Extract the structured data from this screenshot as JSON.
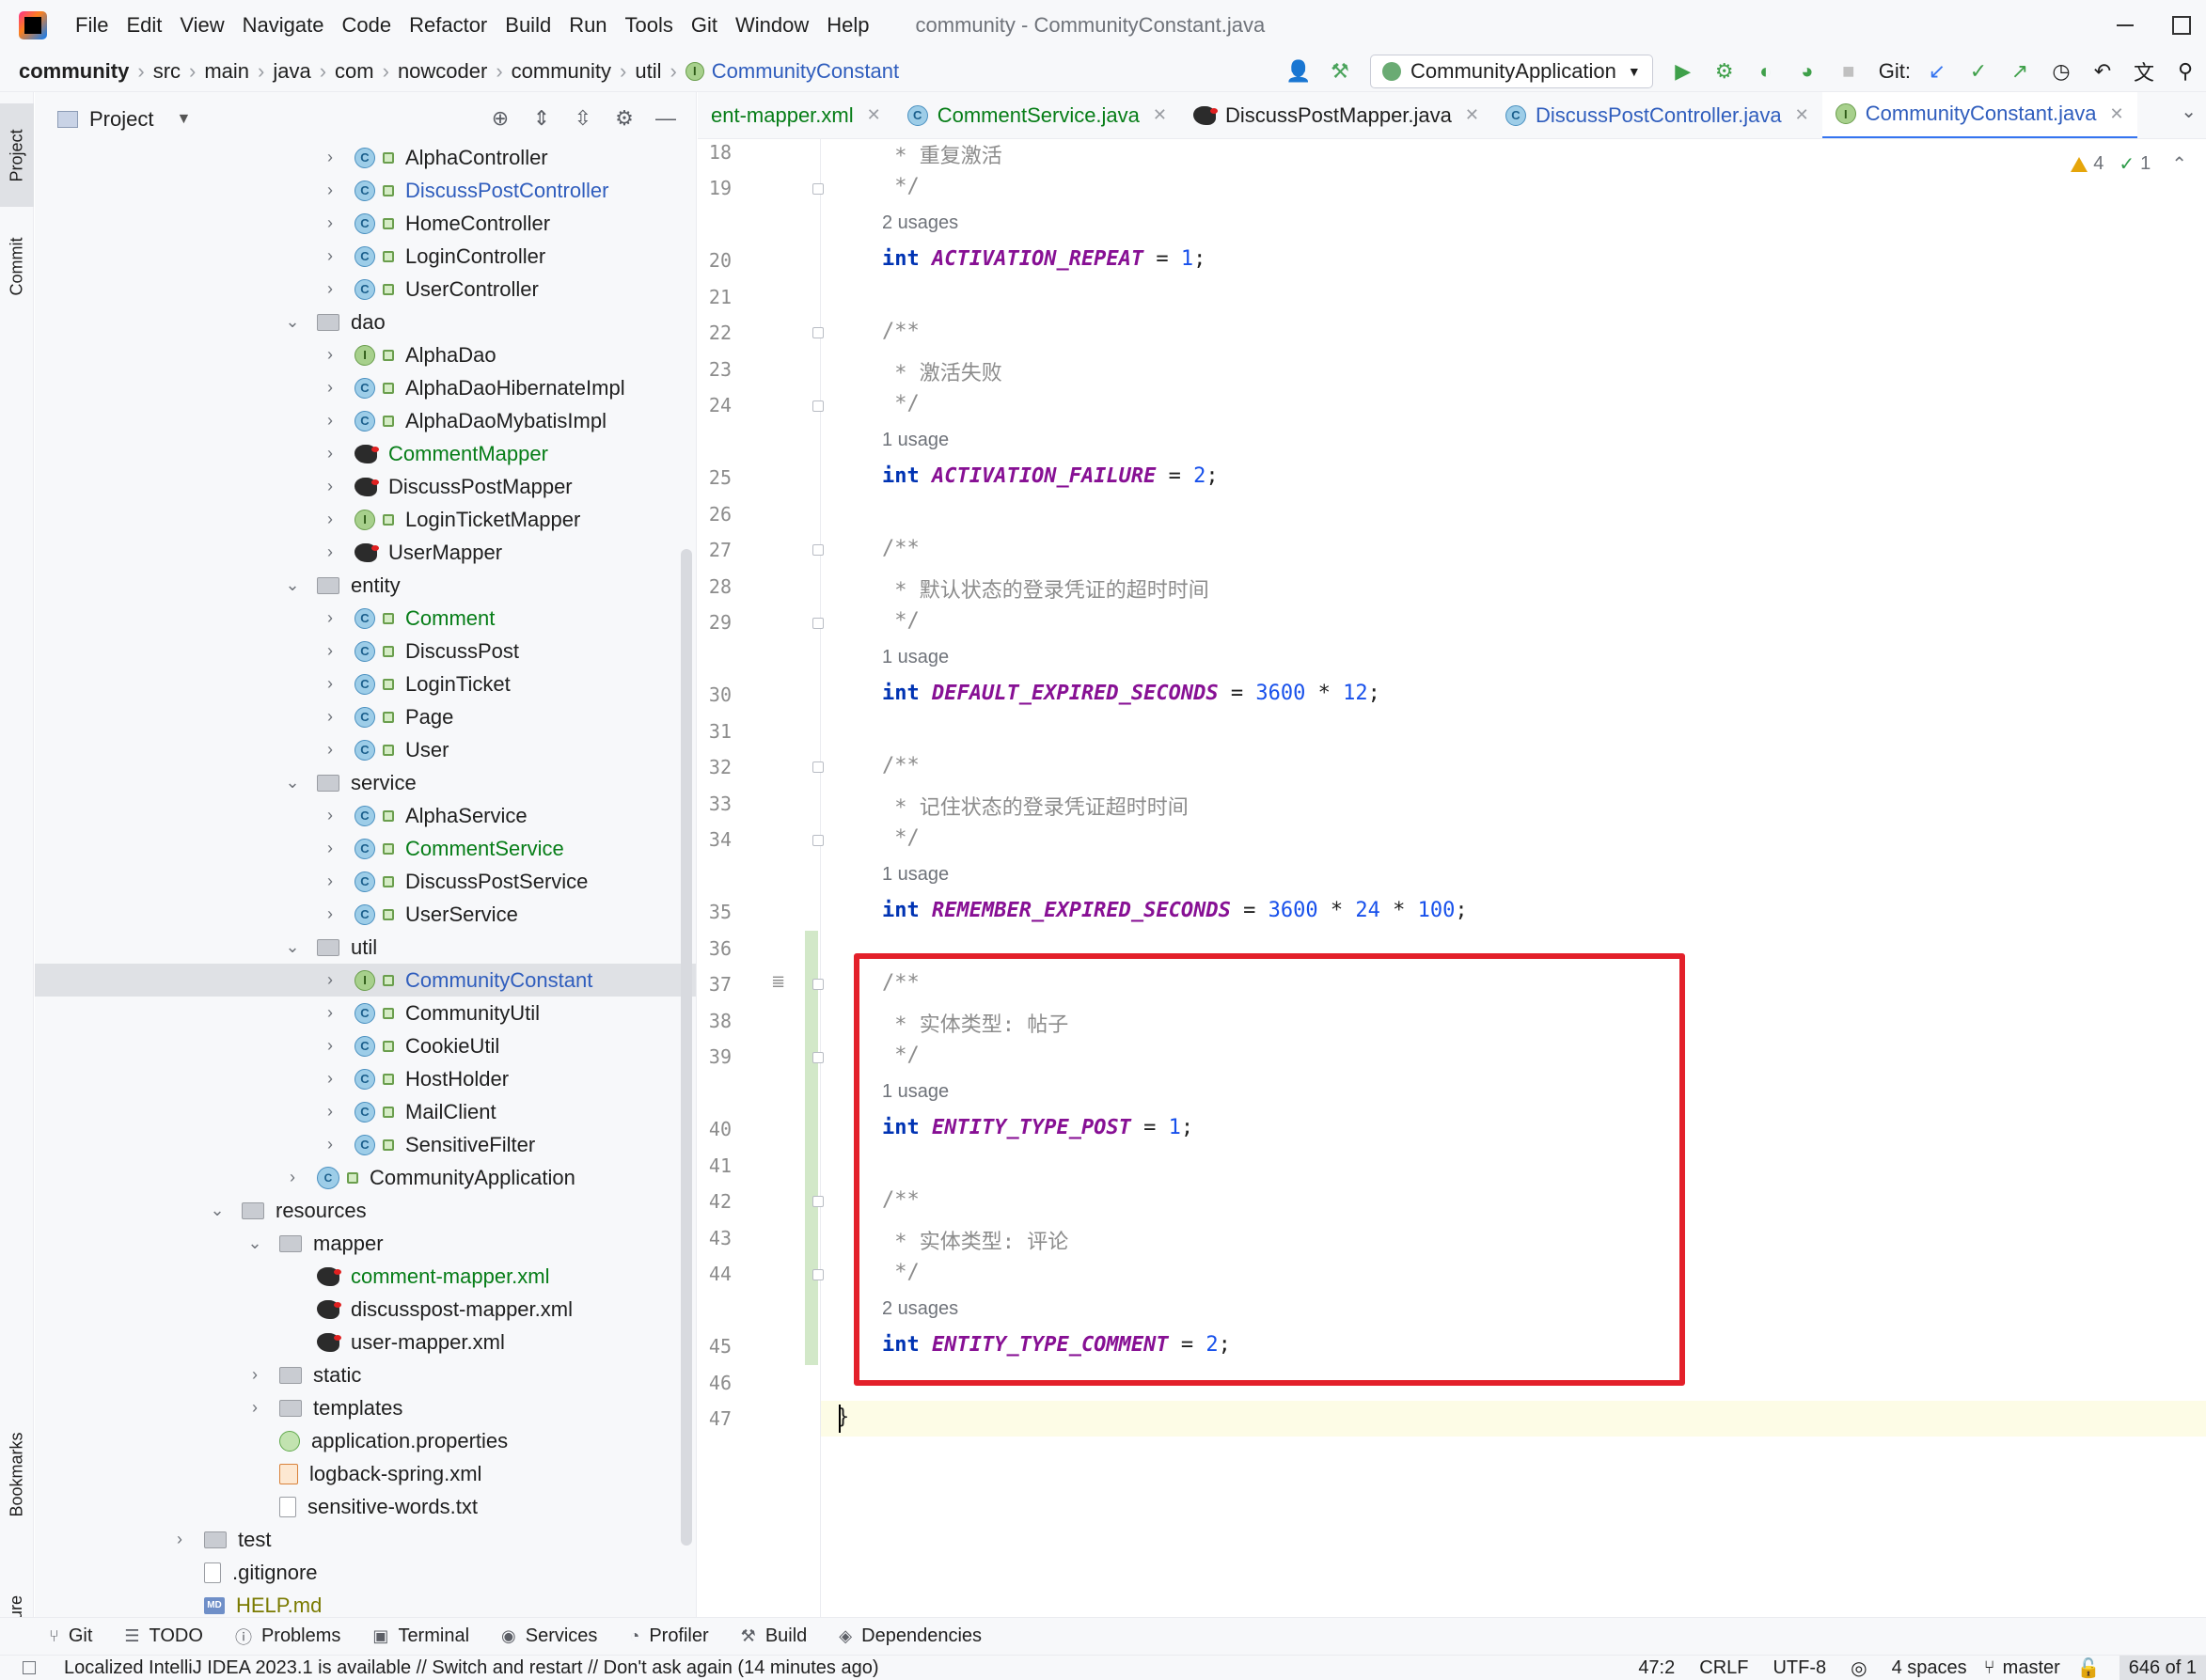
{
  "menubar": {
    "items": [
      "File",
      "Edit",
      "View",
      "Navigate",
      "Code",
      "Refactor",
      "Build",
      "Run",
      "Tools",
      "Git",
      "Window",
      "Help"
    ],
    "window_title": "community - CommunityConstant.java"
  },
  "breadcrumb": [
    "community",
    "src",
    "main",
    "java",
    "com",
    "nowcoder",
    "community",
    "util",
    "CommunityConstant"
  ],
  "toolbar": {
    "run_config": "CommunityApplication",
    "git_label": "Git:"
  },
  "left_strip": {
    "project": "Project",
    "commit": "Commit",
    "bookmarks": "Bookmarks",
    "structure": "Structure"
  },
  "project_panel": {
    "title": "Project",
    "tree": [
      {
        "label": "AlphaController",
        "icon": "class-icon",
        "color": "default"
      },
      {
        "label": "DiscussPostController",
        "icon": "class-icon",
        "color": "blue"
      },
      {
        "label": "HomeController",
        "icon": "class-icon",
        "color": "default"
      },
      {
        "label": "LoginController",
        "icon": "class-icon",
        "color": "default"
      },
      {
        "label": "UserController",
        "icon": "class-icon",
        "color": "default"
      },
      {
        "label": "dao",
        "icon": "package-icon",
        "color": "default"
      },
      {
        "label": "AlphaDao",
        "icon": "interface-icon",
        "color": "default"
      },
      {
        "label": "AlphaDaoHibernateImpl",
        "icon": "class-icon",
        "color": "default"
      },
      {
        "label": "AlphaDaoMybatisImpl",
        "icon": "class-icon",
        "color": "default"
      },
      {
        "label": "CommentMapper",
        "icon": "mybatis-icon",
        "color": "green"
      },
      {
        "label": "DiscussPostMapper",
        "icon": "mybatis-icon",
        "color": "default"
      },
      {
        "label": "LoginTicketMapper",
        "icon": "interface-icon",
        "color": "default"
      },
      {
        "label": "UserMapper",
        "icon": "mybatis-icon",
        "color": "default"
      },
      {
        "label": "entity",
        "icon": "package-icon",
        "color": "default"
      },
      {
        "label": "Comment",
        "icon": "class-icon",
        "color": "green"
      },
      {
        "label": "DiscussPost",
        "icon": "class-icon",
        "color": "default"
      },
      {
        "label": "LoginTicket",
        "icon": "class-icon",
        "color": "default"
      },
      {
        "label": "Page",
        "icon": "class-icon",
        "color": "default"
      },
      {
        "label": "User",
        "icon": "class-icon",
        "color": "default"
      },
      {
        "label": "service",
        "icon": "package-icon",
        "color": "default"
      },
      {
        "label": "AlphaService",
        "icon": "class-icon",
        "color": "default"
      },
      {
        "label": "CommentService",
        "icon": "class-icon",
        "color": "green"
      },
      {
        "label": "DiscussPostService",
        "icon": "class-icon",
        "color": "default"
      },
      {
        "label": "UserService",
        "icon": "class-icon",
        "color": "default"
      },
      {
        "label": "util",
        "icon": "package-icon",
        "color": "default"
      },
      {
        "label": "CommunityConstant",
        "icon": "interface-icon",
        "color": "blue"
      },
      {
        "label": "CommunityUtil",
        "icon": "class-icon",
        "color": "default"
      },
      {
        "label": "CookieUtil",
        "icon": "class-icon",
        "color": "default"
      },
      {
        "label": "HostHolder",
        "icon": "class-icon",
        "color": "default"
      },
      {
        "label": "MailClient",
        "icon": "class-icon",
        "color": "default"
      },
      {
        "label": "SensitiveFilter",
        "icon": "class-icon",
        "color": "default"
      },
      {
        "label": "CommunityApplication",
        "icon": "spring-app-icon",
        "color": "default"
      },
      {
        "label": "resources",
        "icon": "resources-folder-icon",
        "color": "default"
      },
      {
        "label": "mapper",
        "icon": "folder-icon",
        "color": "default"
      },
      {
        "label": "comment-mapper.xml",
        "icon": "mybatis-xml-icon",
        "color": "green"
      },
      {
        "label": "discusspost-mapper.xml",
        "icon": "mybatis-xml-icon",
        "color": "default"
      },
      {
        "label": "user-mapper.xml",
        "icon": "mybatis-xml-icon",
        "color": "default"
      },
      {
        "label": "static",
        "icon": "folder-icon",
        "color": "default"
      },
      {
        "label": "templates",
        "icon": "folder-icon",
        "color": "default"
      },
      {
        "label": "application.properties",
        "icon": "spring-properties-icon",
        "color": "default"
      },
      {
        "label": "logback-spring.xml",
        "icon": "xml-icon",
        "color": "default"
      },
      {
        "label": "sensitive-words.txt",
        "icon": "text-file-icon",
        "color": "default"
      },
      {
        "label": "test",
        "icon": "folder-icon",
        "color": "default"
      },
      {
        "label": ".gitignore",
        "icon": "text-file-icon",
        "color": "default"
      },
      {
        "label": "HELP.md",
        "icon": "markdown-icon",
        "color": "olive"
      }
    ],
    "selected": "CommunityConstant"
  },
  "editor_tabs": [
    {
      "label": "ent-mapper.xml",
      "icon": "mybatis-xml-icon",
      "color": "green"
    },
    {
      "label": "CommentService.java",
      "icon": "class-icon",
      "color": "green"
    },
    {
      "label": "DiscussPostMapper.java",
      "icon": "mybatis-icon",
      "color": "default"
    },
    {
      "label": "DiscussPostController.java",
      "icon": "class-icon",
      "color": "blue"
    },
    {
      "label": "CommunityConstant.java",
      "icon": "interface-icon",
      "color": "blue"
    }
  ],
  "inspection": {
    "warnings": "4",
    "ok": "1"
  },
  "editor": {
    "line_numbers": [
      "18",
      "19",
      "20",
      "21",
      "22",
      "23",
      "24",
      "25",
      "26",
      "27",
      "28",
      "29",
      "30",
      "31",
      "32",
      "33",
      "34",
      "35",
      "36",
      "37",
      "38",
      "39",
      "40",
      "41",
      "42",
      "43",
      "44",
      "45",
      "46",
      "47"
    ],
    "comment_repeat": " * 重复激活",
    "comment_end": " */",
    "comment_start": "/**",
    "comment_failure": " * 激活失败",
    "comment_default_expired": " * 默认状态的登录凭证的超时时间",
    "comment_remember_expired": " * 记住状态的登录凭证超时时间",
    "comment_entity_post": " * 实体类型: 帖子",
    "comment_entity_comment": " * 实体类型: 评论",
    "kw_int": "int",
    "op_eq": " = ",
    "op_mul": " * ",
    "semi": ";",
    "closing_brace": "}",
    "usage_2": "2 usages",
    "usage_1": "1 usage",
    "const_activation_repeat": "ACTIVATION_REPEAT",
    "const_activation_failure": "ACTIVATION_FAILURE",
    "const_default_expired": "DEFAULT_EXPIRED_SECONDS",
    "const_remember_expired": "REMEMBER_EXPIRED_SECONDS",
    "const_entity_post": "ENTITY_TYPE_POST",
    "const_entity_comment": "ENTITY_TYPE_COMMENT",
    "val_1": "1",
    "val_2": "2",
    "val_3600": "3600",
    "val_12": "12",
    "val_24": "24",
    "val_100": "100"
  },
  "bottom_tools": [
    "Git",
    "TODO",
    "Problems",
    "Terminal",
    "Services",
    "Profiler",
    "Build",
    "Dependencies"
  ],
  "statusbar": {
    "message": "Localized IntelliJ IDEA 2023.1 is available // Switch and restart // Don't ask again (14 minutes ago)",
    "position": "47:2",
    "line_sep": "CRLF",
    "encoding": "UTF-8",
    "indent": "4 spaces",
    "branch": "master",
    "memory": "646 of 1"
  },
  "colors": {
    "highlight_box": "#e3202a",
    "accent": "#3574f0",
    "keyword": "#0033b3",
    "constant": "#871094",
    "number": "#1750eb"
  }
}
